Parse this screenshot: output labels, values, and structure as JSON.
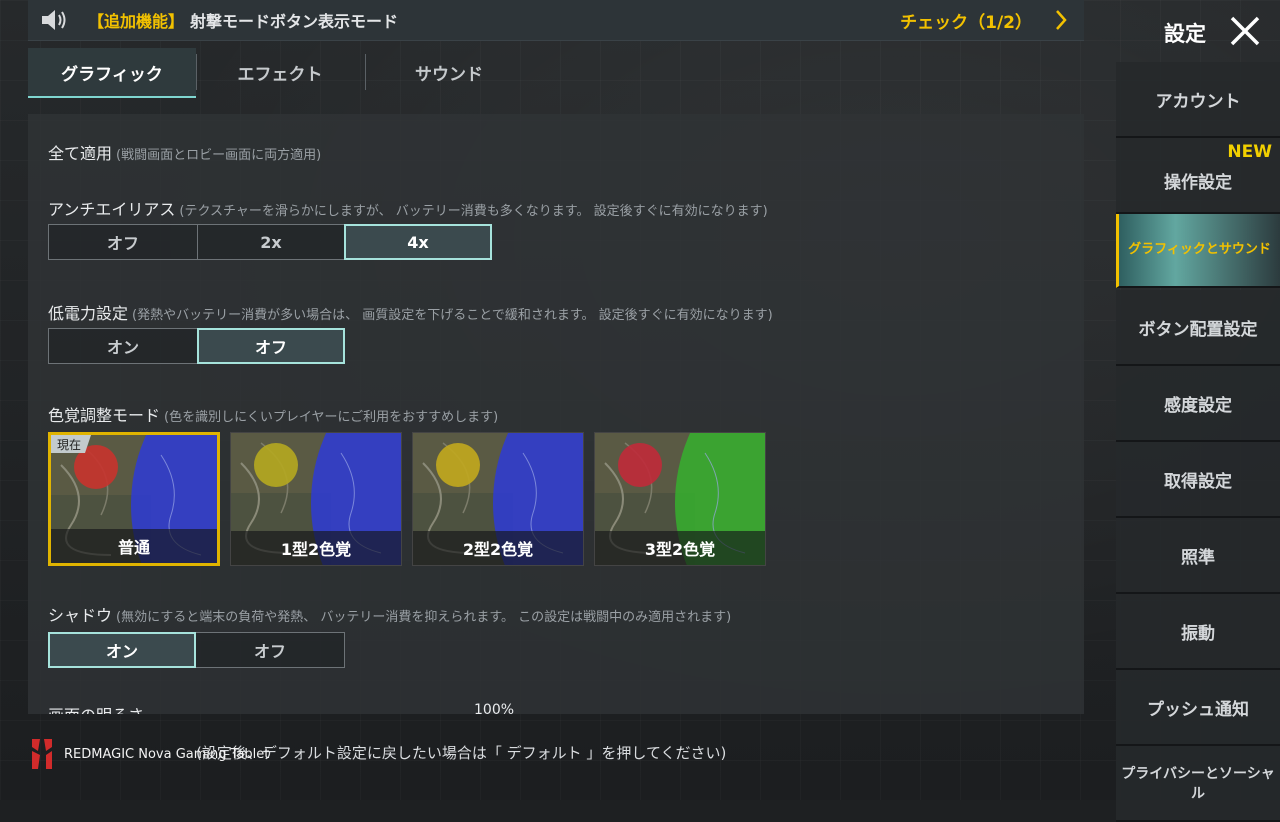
{
  "banner": {
    "tag": "【追加機能】",
    "message": "射撃モードボタン表示モード",
    "check": "チェック（1/2）"
  },
  "header": {
    "title": "設定"
  },
  "tabs": [
    {
      "label": "グラフィック",
      "active": true
    },
    {
      "label": "エフェクト",
      "active": false
    },
    {
      "label": "サウンド",
      "active": false
    }
  ],
  "settings": {
    "apply_all": {
      "title": "全て適用",
      "note": "(戦闘画面とロビー画面に両方適用)"
    },
    "antialias": {
      "title": "アンチエイリアス",
      "note": "(テクスチャーを滑らかにしますが、 バッテリー消費も多くなります。 設定後すぐに有効になります)",
      "options": [
        "オフ",
        "2x",
        "4x"
      ],
      "selected": "4x"
    },
    "low_power": {
      "title": "低電力設定",
      "note": "(発熱やバッテリー消費が多い場合は、 画質設定を下げることで緩和されます。 設定後すぐに有効になります)",
      "options": [
        "オン",
        "オフ"
      ],
      "selected": "オフ"
    },
    "color_mode": {
      "title": "色覚調整モード",
      "note": "(色を識別しにくいプレイヤーにご利用をおすすめします)",
      "current_badge": "現在",
      "cards": [
        {
          "label": "普通",
          "circle": "#c8332e",
          "zone": "#2e3bd6"
        },
        {
          "label": "1型2色覚",
          "circle": "#b5a820",
          "zone": "#2e3bd6"
        },
        {
          "label": "2型2色覚",
          "circle": "#c2a81e",
          "zone": "#2e3bd6"
        },
        {
          "label": "3型2色覚",
          "circle": "#c02a3a",
          "zone": "#36b02e"
        }
      ]
    },
    "shadow": {
      "title": "シャドウ",
      "note": "(無効にすると端末の負荷や発熱、 バッテリー消費を抑えられます。 この設定は戦闘中のみ適用されます)",
      "options": [
        "オン",
        "オフ"
      ],
      "selected": "オン"
    },
    "brightness": {
      "title": "画面の明るさ",
      "value": "100%"
    }
  },
  "footer_note": "(設定後、デフォルト設定に戻したい場合は「 デフォルト 」を押してください)",
  "watermark": "REDMAGIC Nova Gaming Tablet",
  "sidebar": [
    {
      "label": "アカウント"
    },
    {
      "label": "操作設定",
      "badge": "NEW"
    },
    {
      "label": "グラフィックとサウンド",
      "active": true
    },
    {
      "label": "ボタン配置設定"
    },
    {
      "label": "感度設定"
    },
    {
      "label": "取得設定"
    },
    {
      "label": "照準"
    },
    {
      "label": "振動"
    },
    {
      "label": "プッシュ通知"
    },
    {
      "label": "プライバシーとソーシャル"
    }
  ],
  "colors": {
    "accent": "#f2c100",
    "highlight": "#a6e3dc"
  }
}
